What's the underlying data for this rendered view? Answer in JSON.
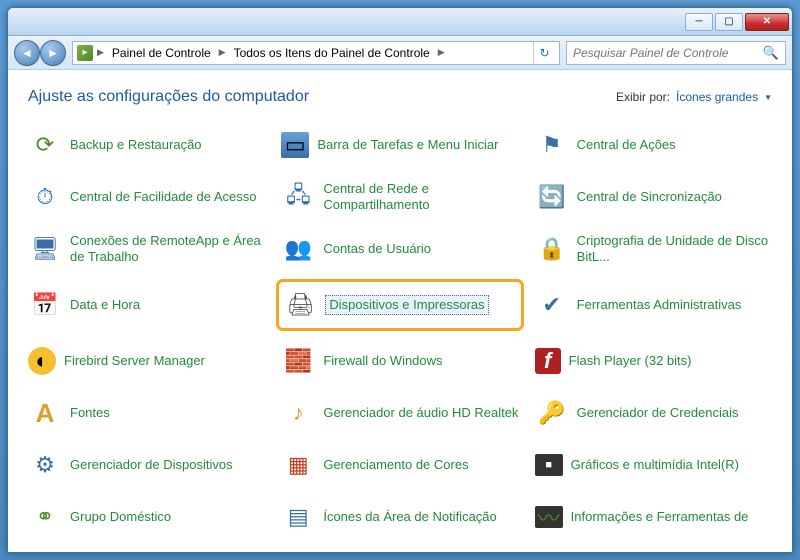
{
  "window": {
    "breadcrumbs": [
      "Painel de Controle",
      "Todos os Itens do Painel de Controle"
    ],
    "search_placeholder": "Pesquisar Painel de Controle"
  },
  "header": {
    "title": "Ajuste as configurações do computador",
    "view_by_label": "Exibir por:",
    "view_by_value": "Ícones grandes"
  },
  "items": [
    {
      "label": "Backup e Restauração",
      "icon": "ic-backup",
      "highlighted": false
    },
    {
      "label": "Barra de Tarefas e Menu Iniciar",
      "icon": "ic-taskbar",
      "highlighted": false
    },
    {
      "label": "Central de Ações",
      "icon": "ic-flag",
      "highlighted": false
    },
    {
      "label": "Central de Facilidade de Acesso",
      "icon": "ic-ease",
      "highlighted": false
    },
    {
      "label": "Central de Rede e Compartilhamento",
      "icon": "ic-network",
      "highlighted": false
    },
    {
      "label": "Central de Sincronização",
      "icon": "ic-sync",
      "highlighted": false
    },
    {
      "label": "Conexões de RemoteApp e Área de Trabalho",
      "icon": "ic-remote",
      "highlighted": false
    },
    {
      "label": "Contas de Usuário",
      "icon": "ic-users",
      "highlighted": false
    },
    {
      "label": "Criptografia de Unidade de Disco BitL...",
      "icon": "ic-bitlocker",
      "highlighted": false
    },
    {
      "label": "Data e Hora",
      "icon": "ic-date",
      "highlighted": false
    },
    {
      "label": "Dispositivos e Impressoras",
      "icon": "ic-devices",
      "highlighted": true
    },
    {
      "label": "Ferramentas Administrativas",
      "icon": "ic-admin",
      "highlighted": false
    },
    {
      "label": "Firebird Server Manager",
      "icon": "ic-firebird",
      "highlighted": false
    },
    {
      "label": "Firewall do Windows",
      "icon": "ic-firewall",
      "highlighted": false
    },
    {
      "label": "Flash Player (32 bits)",
      "icon": "ic-flash",
      "highlighted": false
    },
    {
      "label": "Fontes",
      "icon": "ic-fonts",
      "highlighted": false
    },
    {
      "label": "Gerenciador de áudio HD Realtek",
      "icon": "ic-audio",
      "highlighted": false
    },
    {
      "label": "Gerenciador de Credenciais",
      "icon": "ic-cred",
      "highlighted": false
    },
    {
      "label": "Gerenciador de Dispositivos",
      "icon": "ic-devmgr",
      "highlighted": false
    },
    {
      "label": "Gerenciamento de Cores",
      "icon": "ic-color",
      "highlighted": false
    },
    {
      "label": "Gráficos e multimídia Intel(R)",
      "icon": "ic-intel",
      "highlighted": false
    },
    {
      "label": "Grupo Doméstico",
      "icon": "ic-homegroup",
      "highlighted": false
    },
    {
      "label": "Ícones da Área de Notificação",
      "icon": "ic-notif",
      "highlighted": false
    },
    {
      "label": "Informações e Ferramentas de",
      "icon": "ic-perf",
      "highlighted": false
    }
  ],
  "icon_glyphs": {
    "ic-backup": "⟳",
    "ic-taskbar": "▭",
    "ic-flag": "⚑",
    "ic-ease": "⏱",
    "ic-network": "🖧",
    "ic-sync": "🔄",
    "ic-remote": "🖥",
    "ic-users": "👥",
    "ic-bitlocker": "🔒",
    "ic-date": "📅",
    "ic-devices": "🖨",
    "ic-admin": "✔",
    "ic-firebird": "◐",
    "ic-firewall": "🧱",
    "ic-flash": "f",
    "ic-fonts": "A",
    "ic-audio": "♪",
    "ic-cred": "🔑",
    "ic-devmgr": "⚙",
    "ic-color": "▦",
    "ic-intel": "■",
    "ic-homegroup": "⚭",
    "ic-notif": "▤",
    "ic-perf": "〰"
  }
}
